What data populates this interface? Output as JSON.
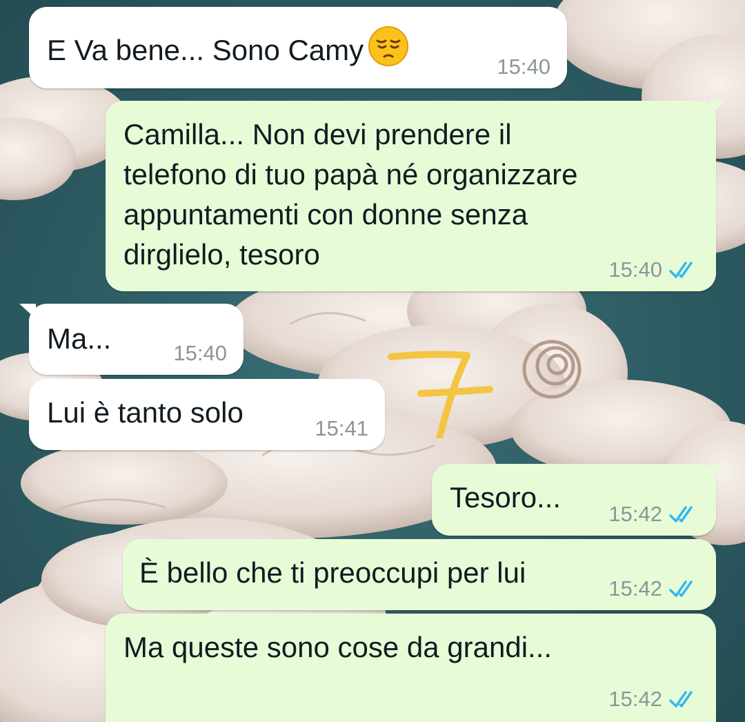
{
  "colors": {
    "incoming_bubble": "#ffffff",
    "outgoing_bubble": "#e7fcd6",
    "timestamp": "#8b9599",
    "read_ticks": "#34b7f1",
    "scribble": "#f4c542"
  },
  "messages": [
    {
      "direction": "incoming",
      "text": "E Va bene... Sono Camy",
      "emoji": "pensive-face",
      "time": "15:40"
    },
    {
      "direction": "outgoing",
      "text": "Camilla... Non devi prendere il\ntelefono di tuo papà né organizzare\nappuntamenti con donne senza\ndirglielo, tesoro",
      "time": "15:40",
      "status": "read-double-check"
    },
    {
      "direction": "incoming",
      "text": "Ma...",
      "time": "15:40"
    },
    {
      "direction": "incoming",
      "text": "Lui è tanto solo",
      "time": "15:41"
    },
    {
      "direction": "outgoing",
      "text": "Tesoro...",
      "time": "15:42",
      "status": "read-double-check"
    },
    {
      "direction": "outgoing",
      "text": "È bello che ti preoccupi per lui",
      "time": "15:42",
      "status": "read-double-check"
    },
    {
      "direction": "outgoing",
      "text": "Ma queste sono cose da grandi...",
      "time": "15:42",
      "status": "read-double-check"
    }
  ]
}
